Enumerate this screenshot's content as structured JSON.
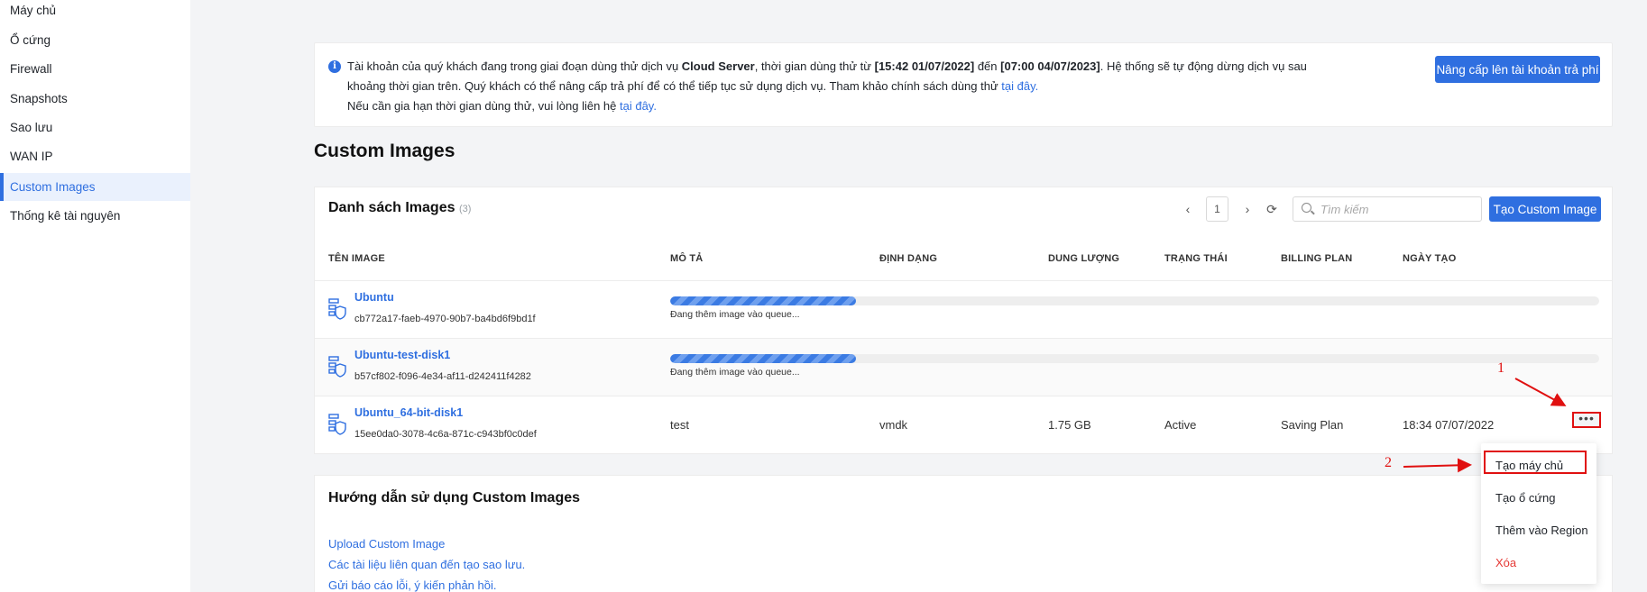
{
  "sidebar": {
    "items": [
      {
        "label": "Máy chủ"
      },
      {
        "label": "Ổ cứng"
      },
      {
        "label": "Firewall"
      },
      {
        "label": "Snapshots"
      },
      {
        "label": "Sao lưu"
      },
      {
        "label": "WAN IP"
      },
      {
        "label": "Custom Images",
        "active": true
      },
      {
        "label": "Thống kê tài nguyên"
      }
    ]
  },
  "notice": {
    "line1_a": "Tài khoản của quý khách đang trong giai đoạn dùng thử dịch vụ ",
    "line1_service": "Cloud Server",
    "line1_b": ", thời gian dùng thử từ ",
    "start": "[15:42 01/07/2022]",
    "line1_c": " đến ",
    "end": "[07:00 04/07/2023]",
    "line1_d": ". Hệ thống sẽ tự động dừng dịch vụ sau khoảng thời gian trên. Quý khách có thể nâng cấp trả phí để có thể tiếp tục sử dụng dịch vụ. Tham khảo chính sách dùng thử ",
    "policy_link": "tại đây.",
    "line2": "Nếu cần gia hạn thời gian dùng thử, vui lòng liên hệ ",
    "contact_link": "tại đây.",
    "upgrade_button": "Nâng cấp lên tài khoản trả phí"
  },
  "page_title": "Custom Images",
  "list": {
    "title": "Danh sách Images",
    "count": "(3)",
    "page": "1",
    "prev_icon": "‹",
    "next_icon": "›",
    "refresh_icon": "⟳",
    "search_placeholder": "Tìm kiếm",
    "create_button": "Tạo Custom Image",
    "columns": [
      "TÊN IMAGE",
      "MÔ TẢ",
      "ĐỊNH DẠNG",
      "DUNG LƯỢNG",
      "TRẠNG THÁI",
      "BILLING PLAN",
      "NGÀY TẠO"
    ],
    "rows": [
      {
        "name": "Ubuntu",
        "id": "cb772a17-faeb-4970-90b7-ba4bd6f9bd1f",
        "progress": 0.2,
        "progress_text": "Đang thêm image vào queue..."
      },
      {
        "name": "Ubuntu-test-disk1",
        "id": "b57cf802-f096-4e34-af11-d242411f4282",
        "progress": 0.2,
        "progress_text": "Đang thêm image vào queue..."
      },
      {
        "name": "Ubuntu_64-bit-disk1",
        "id": "15ee0da0-3078-4c6a-871c-c943bf0c0def",
        "description": "test",
        "format": "vmdk",
        "size": "1.75 GB",
        "status": "Active",
        "billing": "Saving Plan",
        "created": "18:34 07/07/2022",
        "more_icon": "•••"
      }
    ]
  },
  "guide": {
    "title": "Hướng dẫn sử dụng Custom Images",
    "links": [
      "Upload Custom Image",
      "Các tài liệu liên quan đến tạo sao lưu.",
      "Gửi báo cáo lỗi, ý kiến phản hồi."
    ]
  },
  "context_menu": {
    "items": [
      {
        "label": "Tạo máy chủ"
      },
      {
        "label": "Tạo ổ cứng"
      },
      {
        "label": "Thêm vào Region"
      },
      {
        "label": "Xóa",
        "danger": true
      }
    ]
  },
  "annotations": {
    "step1": "1",
    "step2": "2",
    "color": "#e01010"
  },
  "colors": {
    "accent": "#2f6fe0",
    "danger": "#e53935"
  }
}
